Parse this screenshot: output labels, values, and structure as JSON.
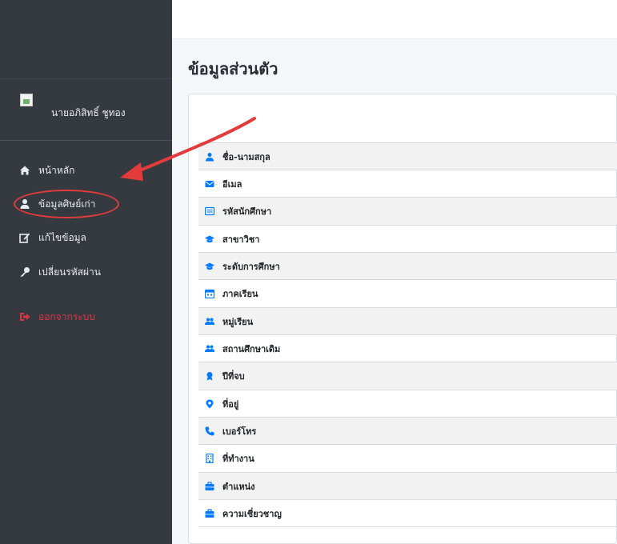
{
  "sidebar": {
    "profile_name": "นายอภิสิทธิ์ ชูทอง",
    "items": [
      {
        "label": "หน้าหลัก",
        "icon": "home-icon"
      },
      {
        "label": "ข้อมูลศิษย์เก่า",
        "icon": "user-icon"
      },
      {
        "label": "แก้ไขข้อมูล",
        "icon": "edit-icon"
      },
      {
        "label": "เปลี่ยนรหัสผ่าน",
        "icon": "key-icon"
      }
    ],
    "logout_label": "ออกจากระบบ",
    "logout_color": "#dc3545"
  },
  "page": {
    "title": "ข้อมูลส่วนตัว"
  },
  "fields": [
    {
      "label": "ชื่อ-นามสกุล",
      "icon": "user-icon"
    },
    {
      "label": "อีเมล",
      "icon": "mail-icon"
    },
    {
      "label": "รหัสนักศึกษา",
      "icon": "id-card-icon"
    },
    {
      "label": "สาขาวิชา",
      "icon": "graduation-cap-icon"
    },
    {
      "label": "ระดับการศึกษา",
      "icon": "graduation-cap-icon"
    },
    {
      "label": "ภาคเรียน",
      "icon": "calendar-icon"
    },
    {
      "label": "หมู่เรียน",
      "icon": "users-icon"
    },
    {
      "label": "สถานศึกษาเดิม",
      "icon": "users-icon"
    },
    {
      "label": "ปีที่จบ",
      "icon": "award-icon"
    },
    {
      "label": "ที่อยู่",
      "icon": "map-marker-icon"
    },
    {
      "label": "เบอร์โทร",
      "icon": "phone-icon"
    },
    {
      "label": "ที่ทำงาน",
      "icon": "building-icon"
    },
    {
      "label": "ตำแหน่ง",
      "icon": "briefcase-icon"
    },
    {
      "label": "ความเชี่ยวชาญ",
      "icon": "briefcase-icon"
    }
  ],
  "colors": {
    "accent": "#007bff",
    "annotation": "#e33b3b",
    "sidebar": "#343a40"
  }
}
